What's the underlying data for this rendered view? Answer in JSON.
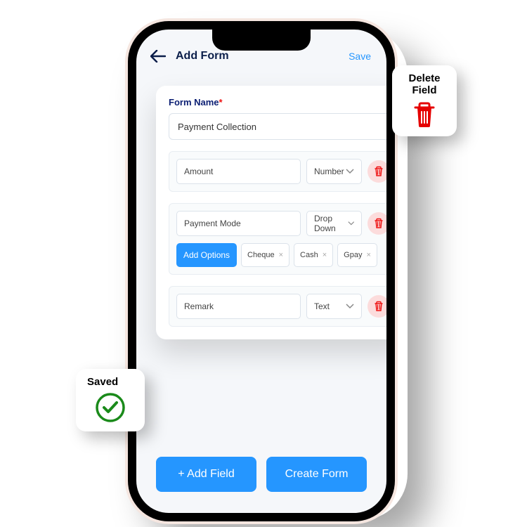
{
  "header": {
    "title": "Add Form",
    "save": "Save"
  },
  "form": {
    "name_label": "Form Name",
    "required_mark": "*",
    "name_value": "Payment Collection"
  },
  "fields": [
    {
      "label": "Amount",
      "type": "Number"
    },
    {
      "label": "Payment Mode",
      "type": "Drop Down",
      "options": [
        "Cheque",
        "Cash",
        "Gpay"
      ],
      "add_options_label": "Add Options"
    },
    {
      "label": "Remark",
      "type": "Text"
    }
  ],
  "buttons": {
    "add_field": "+ Add Field",
    "create_form": "Create Form"
  },
  "callouts": {
    "delete": "Delete\nField",
    "saved": "Saved"
  }
}
